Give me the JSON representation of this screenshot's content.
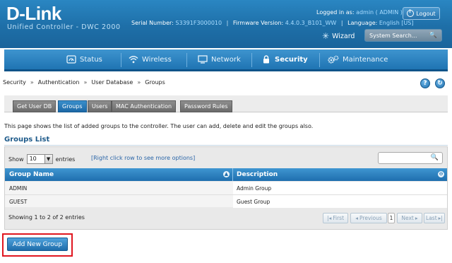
{
  "header": {
    "brand": "D-Link",
    "subtitle": "Unified Controller - DWC 2000",
    "serial_label": "Serial Number:",
    "serial_value": "S3391F3000010",
    "firmware_label": "Firmware Version:",
    "firmware_value": "4.4.0.3_B101_WW",
    "language_label": "Language:",
    "language_value": "English [US]",
    "logged_label": "Logged in as:",
    "logged_value": "admin ( ADMIN )",
    "logout_label": "Logout",
    "wizard_label": "Wizard",
    "search_placeholder": "System Search..."
  },
  "nav": {
    "items": [
      {
        "label": "Status",
        "icon": "gauge-icon"
      },
      {
        "label": "Wireless",
        "icon": "wifi-icon"
      },
      {
        "label": "Network",
        "icon": "monitor-icon"
      },
      {
        "label": "Security",
        "icon": "lock-icon"
      },
      {
        "label": "Maintenance",
        "icon": "gears-icon"
      }
    ],
    "active": "Security"
  },
  "breadcrumb": {
    "items": [
      "Security",
      "Authentication",
      "User Database",
      "Groups"
    ],
    "help_label": "?",
    "refresh_label": "↻"
  },
  "tabs": {
    "items": [
      "Get User DB",
      "Groups",
      "Users",
      "MAC Authentication",
      "Password Rules"
    ],
    "active": "Groups"
  },
  "description": "This page shows the list of added groups to the controller. The user can add, delete and edit the groups also.",
  "section_title": "Groups List",
  "table": {
    "show_label": "Show",
    "show_value": "10",
    "entries_label": "entries",
    "right_click_hint": "[Right click row to see more options]",
    "columns": [
      "Group Name",
      "Description"
    ],
    "rows": [
      {
        "name": "ADMIN",
        "description": "Admin Group"
      },
      {
        "name": "GUEST",
        "description": "Guest Group"
      }
    ],
    "info": "Showing 1 to 2 of 2 entries",
    "pager": {
      "first": "First",
      "previous": "Previous",
      "page": "1",
      "next": "Next",
      "last": "Last"
    }
  },
  "actions": {
    "add_new_group": "Add New Group"
  },
  "colors": {
    "header_blue": "#1e6fa8",
    "highlight_red": "#e0161f"
  }
}
